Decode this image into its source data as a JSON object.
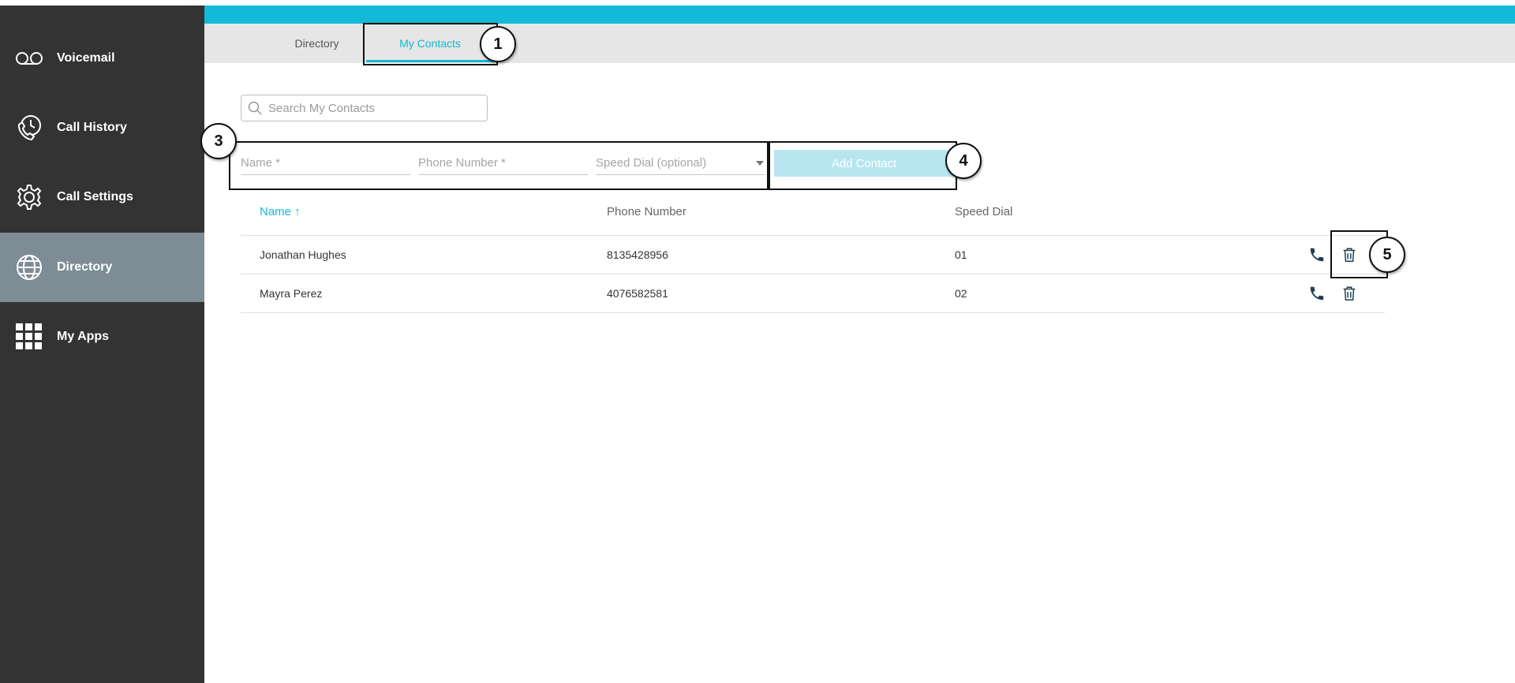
{
  "colors": {
    "accent": "#13b9d6",
    "sidebar": "#333333",
    "sidebar_active": "#7e8c95",
    "tabstrip": "#e6e6e6",
    "button_disabled": "#b8e6f0"
  },
  "sidebar": {
    "items": [
      {
        "label": "Voicemail",
        "icon": "voicemail-icon"
      },
      {
        "label": "Call History",
        "icon": "call-history-icon"
      },
      {
        "label": "Call Settings",
        "icon": "gear-icon"
      },
      {
        "label": "Directory",
        "icon": "globe-icon",
        "active": true
      },
      {
        "label": "My Apps",
        "icon": "apps-grid-icon"
      }
    ]
  },
  "tabs": [
    {
      "label": "Directory"
    },
    {
      "label": "My Contacts",
      "active": true
    }
  ],
  "search": {
    "placeholder": "Search My Contacts"
  },
  "form": {
    "name_placeholder": "Name *",
    "phone_placeholder": "Phone Number *",
    "speed_dial_placeholder": "Speed Dial (optional)",
    "add_button": "Add Contact"
  },
  "table": {
    "headers": {
      "name": "Name",
      "phone": "Phone Number",
      "speed_dial": "Speed Dial"
    },
    "sort_indicator": "↑",
    "rows": [
      {
        "name": "Jonathan Hughes",
        "phone": "8135428956",
        "speed_dial": "01"
      },
      {
        "name": "Mayra Perez",
        "phone": "4076582581",
        "speed_dial": "02"
      }
    ]
  },
  "annotations": [
    "1",
    "3",
    "4",
    "5"
  ]
}
